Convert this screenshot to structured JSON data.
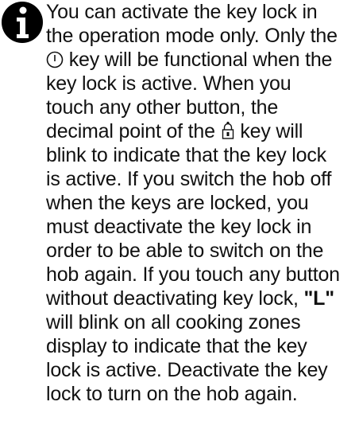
{
  "note": {
    "icon": "info-icon",
    "lines": [
      "You can activate the key lock in",
      "the operation mode only. Only the",
      "key will be functional when the",
      "key lock is active. When you",
      "touch any other button, the",
      "decimal point of the",
      "key will",
      "blink to indicate that the key lock",
      "is active. If you switch the hob off",
      "when the keys are locked, you",
      "must deactivate the key lock in",
      "order to be able to switch on the",
      "hob again. If you touch any button",
      "without deactivating key lock,",
      "\"L\"",
      "will blink on all cooking zones",
      "display to indicate that the key",
      "lock is active. Deactivate the key",
      "lock to turn on the hob again."
    ],
    "power_symbol": "power-icon",
    "lock_symbol": "lock-icon"
  }
}
